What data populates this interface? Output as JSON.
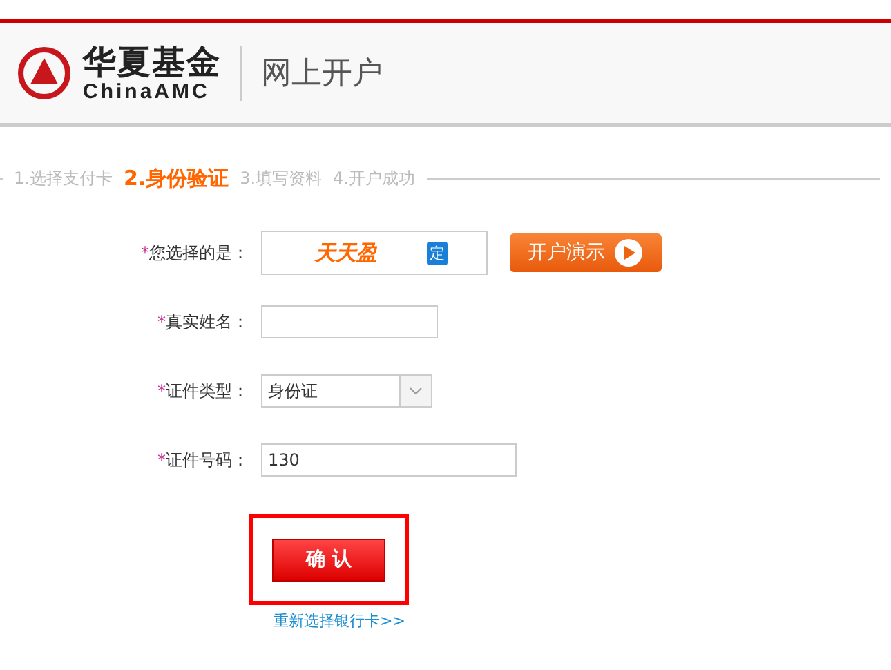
{
  "header": {
    "brand_cn": "华夏基金",
    "brand_en": "ChinaAMC",
    "title": "网上开户"
  },
  "steps": [
    {
      "label": "1.选择支付卡",
      "selected": false
    },
    {
      "label": "2.身份验证",
      "selected": true
    },
    {
      "label": "3.填写资料",
      "selected": false
    },
    {
      "label": "4.开户成功",
      "selected": false
    }
  ],
  "form": [
    {
      "kind": "product",
      "mark": "*",
      "label": "您选择的是：",
      "logo": "天天盈",
      "badge": "定",
      "demo_button": "开户演示"
    },
    {
      "kind": "text",
      "mark": "*",
      "label": "真实姓名："
    },
    {
      "kind": "select",
      "mark": "*",
      "label": "证件类型：",
      "value": "身份证"
    },
    {
      "kind": "text",
      "mark": "*",
      "label": "证件号码：",
      "value": "130"
    }
  ],
  "confirm_button": "确 认",
  "highlighted": true,
  "link": "重新选择银行卡>>"
}
